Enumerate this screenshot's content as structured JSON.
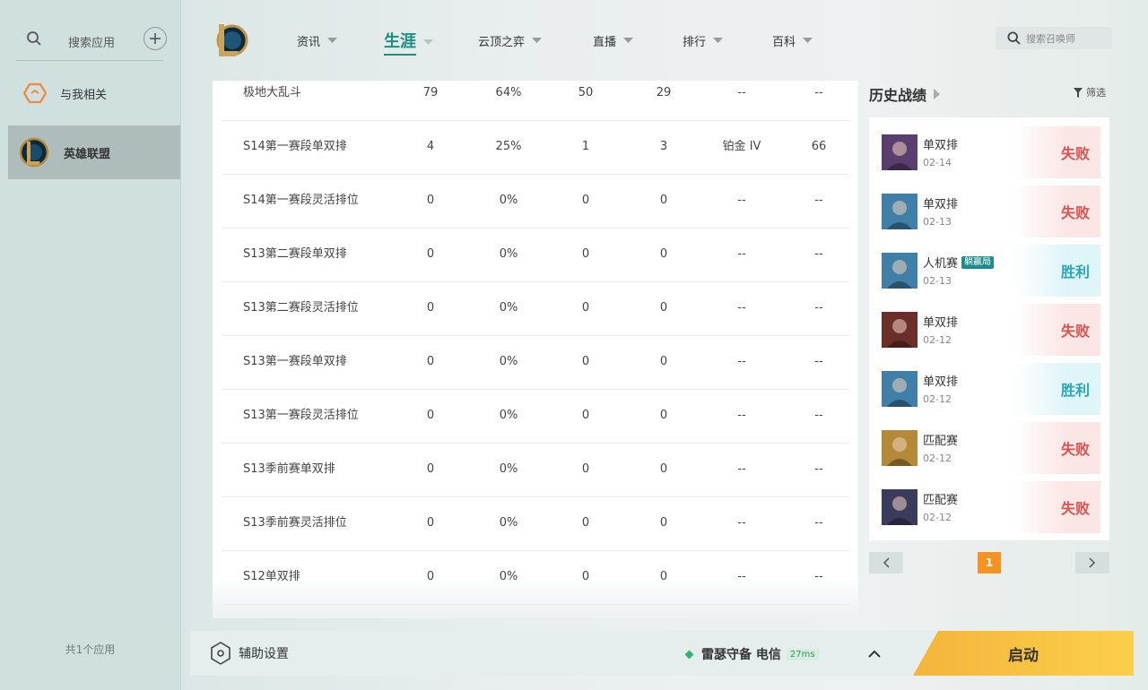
{
  "sidebar": {
    "search_label": "搜索应用",
    "items": [
      {
        "label": "与我相关"
      },
      {
        "label": "英雄联盟"
      }
    ],
    "app_count": "共1个应用"
  },
  "nav": {
    "items": [
      {
        "label": "资讯"
      },
      {
        "label": "生涯"
      },
      {
        "label": "云顶之弈"
      },
      {
        "label": "直播"
      },
      {
        "label": "排行"
      },
      {
        "label": "百科"
      }
    ],
    "search_placeholder": "搜索召唤师"
  },
  "table": {
    "rows": [
      [
        "极地大乱斗",
        "79",
        "64%",
        "50",
        "29",
        "--",
        "--"
      ],
      [
        "S14第一赛段单双排",
        "4",
        "25%",
        "1",
        "3",
        "铂金 IV",
        "66"
      ],
      [
        "S14第一赛段灵活排位",
        "0",
        "0%",
        "0",
        "0",
        "--",
        "--"
      ],
      [
        "S13第二赛段单双排",
        "0",
        "0%",
        "0",
        "0",
        "--",
        "--"
      ],
      [
        "S13第二赛段灵活排位",
        "0",
        "0%",
        "0",
        "0",
        "--",
        "--"
      ],
      [
        "S13第一赛段单双排",
        "0",
        "0%",
        "0",
        "0",
        "--",
        "--"
      ],
      [
        "S13第一赛段灵活排位",
        "0",
        "0%",
        "0",
        "0",
        "--",
        "--"
      ],
      [
        "S13季前赛单双排",
        "0",
        "0%",
        "0",
        "0",
        "--",
        "--"
      ],
      [
        "S13季前赛灵活排位",
        "0",
        "0%",
        "0",
        "0",
        "--",
        "--"
      ],
      [
        "S12单双排",
        "0",
        "0%",
        "0",
        "0",
        "--",
        "--"
      ]
    ]
  },
  "history": {
    "title": "历史战绩",
    "filter_label": "筛选",
    "matches": [
      {
        "mode": "单双排",
        "tag": "",
        "date": "02-14",
        "result": "失败",
        "champion_color": "#5a3e6e",
        "champion_icon": "kaisa-portrait"
      },
      {
        "mode": "单双排",
        "tag": "",
        "date": "02-13",
        "result": "失败",
        "champion_color": "#3f7fa8",
        "champion_icon": "jinx-portrait"
      },
      {
        "mode": "人机赛",
        "tag": "躺赢局",
        "date": "02-13",
        "result": "胜利",
        "champion_color": "#3f7fa8",
        "champion_icon": "jinx-portrait"
      },
      {
        "mode": "单双排",
        "tag": "",
        "date": "02-12",
        "result": "失败",
        "champion_color": "#6b2f2a",
        "champion_icon": "darius-portrait"
      },
      {
        "mode": "单双排",
        "tag": "",
        "date": "02-12",
        "result": "胜利",
        "champion_color": "#3f7fa8",
        "champion_icon": "jinx-portrait"
      },
      {
        "mode": "匹配赛",
        "tag": "",
        "date": "02-12",
        "result": "失败",
        "champion_color": "#b48a3a",
        "champion_icon": "ezreal-portrait"
      },
      {
        "mode": "匹配赛",
        "tag": "",
        "date": "02-12",
        "result": "失败",
        "champion_color": "#3b3b5e",
        "champion_icon": "kayn-portrait"
      }
    ],
    "current_page": "1"
  },
  "bottom": {
    "assist_label": "辅助设置",
    "server_name": "雷瑟守备 电信",
    "ping": "27ms",
    "launch_label": "启动"
  },
  "colors": {
    "accent": "#1c8f82",
    "lose": "#d9534f",
    "win": "#2aa7b5",
    "launch": "#f4b53a",
    "page_active": "#f39422"
  }
}
